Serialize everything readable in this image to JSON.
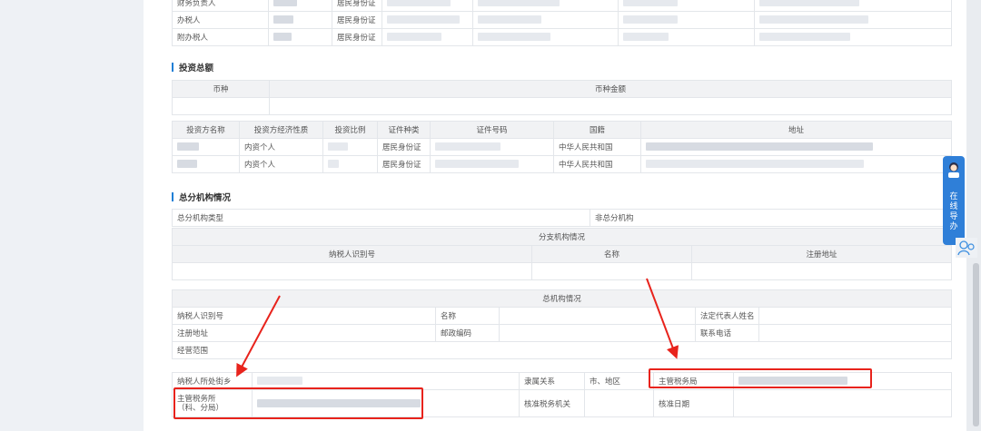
{
  "colors": {
    "accent": "#1f7fd6",
    "annotation_red": "#e8231c",
    "widget_blue": "#2f7fd8"
  },
  "top_rows": [
    {
      "role": "财务负责人",
      "id_type": "居民身份证"
    },
    {
      "role": "办税人",
      "id_type": "居民身份证"
    },
    {
      "role": "附办税人",
      "id_type": "居民身份证"
    }
  ],
  "investment": {
    "title": "投资总额",
    "currency_header": "币种",
    "amount_header": "币种金额",
    "headers": [
      "投资方名称",
      "投资方经济性质",
      "投资比例",
      "证件种类",
      "证件号码",
      "国籍",
      "地址"
    ],
    "rows": [
      {
        "nature": "内资个人",
        "id_type": "居民身份证",
        "nationality": "中华人民共和国"
      },
      {
        "nature": "内资个人",
        "id_type": "居民身份证",
        "nationality": "中华人民共和国"
      }
    ]
  },
  "branch": {
    "title": "总分机构情况",
    "type_label": "总分机构类型",
    "type_value": "非总分机构",
    "branch_section": "分支机构情况",
    "branch_headers": [
      "纳税人识别号",
      "名称",
      "注册地址"
    ],
    "hq_section": "总机构情况",
    "hq_taxpayer_id": "纳税人识别号",
    "hq_name": "名称",
    "hq_legal_rep": "法定代表人姓名",
    "hq_reg_address": "注册地址",
    "hq_postcode": "邮政编码",
    "hq_phone": "联系电话",
    "hq_scope": "经营范围",
    "street_label": "纳税人所处街乡",
    "affiliation_label": "隶属关系",
    "affiliation_value": "市、地区",
    "tax_bureau_label": "主管税务局",
    "tax_office_label_line1": "主管税务所",
    "tax_office_label_line2": "（科、分局）",
    "approving_org_label": "核准税务机关",
    "approval_date_label": "核准日期"
  },
  "side_widget": {
    "text": "在线导办",
    "icon": "support-agent-icon",
    "people_icon": "people-icon"
  }
}
